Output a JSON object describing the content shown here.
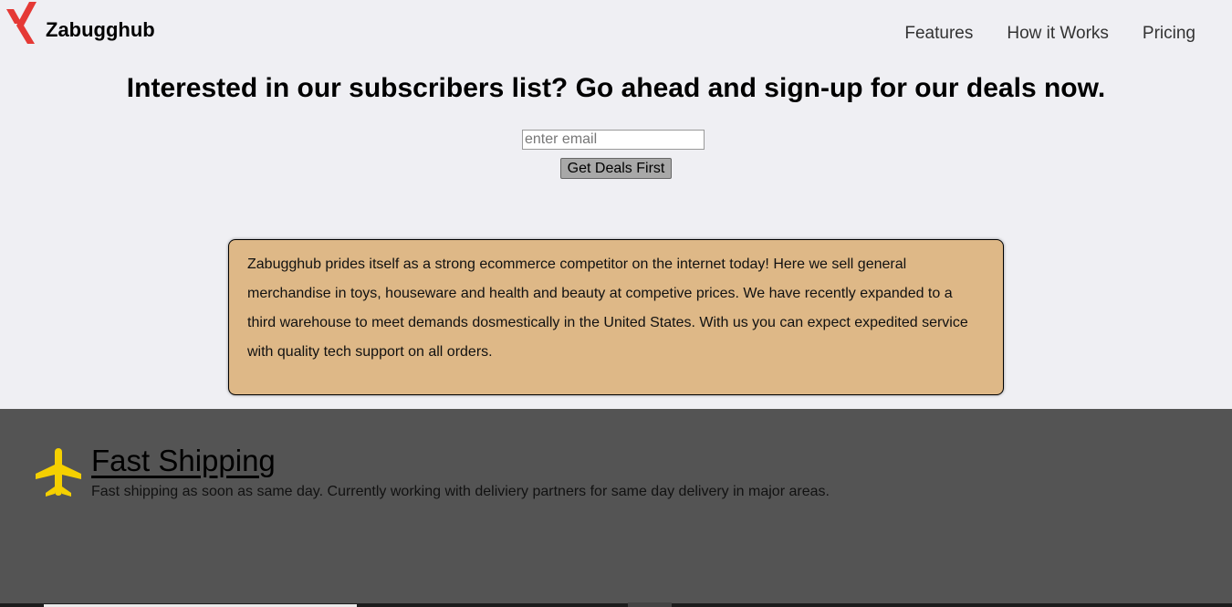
{
  "header": {
    "brand": "Zabugghub",
    "logo_icon": "x-logo-icon",
    "nav": [
      {
        "label": "Features"
      },
      {
        "label": "How it Works"
      },
      {
        "label": "Pricing"
      }
    ]
  },
  "hero": {
    "title": "Interested in our subscribers list? Go ahead and sign-up for our deals now.",
    "email_placeholder": "enter email",
    "email_value": "",
    "button_label": "Get Deals First"
  },
  "about": {
    "text": "Zabugghub prides itself as a strong ecommerce competitor on the internet today! Here we sell general merchandise in toys, houseware and health and beauty at competive prices. We have recently expanded to a third warehouse to meet demands dosmestically in the United States. With us you can expect expedited service with quality tech support on all orders."
  },
  "features": [
    {
      "icon": "airplane-icon",
      "title": "Fast Shipping",
      "description": "Fast shipping as soon as same day. Currently working with deliviery partners for same day delivery in major areas."
    }
  ],
  "colors": {
    "background": "#efeff3",
    "logo_red": "#e53935",
    "about_box": "#deb887",
    "features_bg": "#545454",
    "plane_yellow": "#f5d000",
    "button_bg": "#a8a8a8"
  }
}
